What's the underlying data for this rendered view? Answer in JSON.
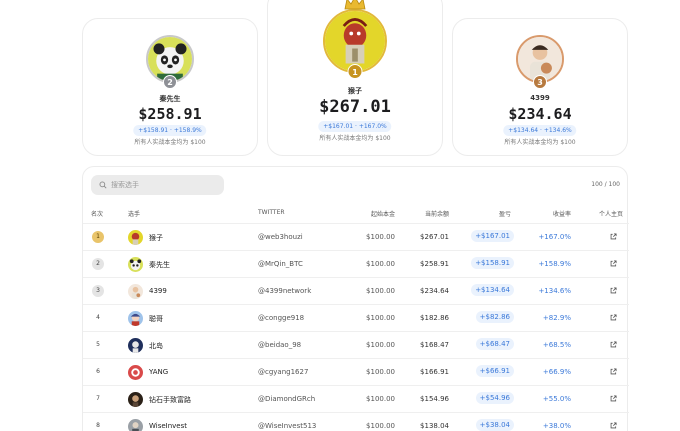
{
  "colors": {
    "accent": "#3b79d9",
    "pill_bg": "#eaf2fd",
    "gold": "#e2b93b",
    "silver": "#c9c9c9",
    "bronze": "#d99a6c"
  },
  "podium": [
    {
      "rank": "2",
      "name": "秦先生",
      "balance": "$258.91",
      "pnl": "+$158.91",
      "rate": "+158.9%",
      "note": "所有人实战本金均为 $100",
      "avatar": "panda-avatar"
    },
    {
      "rank": "1",
      "name": "猴子",
      "balance": "$267.01",
      "pnl": "+$167.01",
      "rate": "+167.0%",
      "note": "所有人实战本金均为 $100",
      "avatar": "monkey-avatar"
    },
    {
      "rank": "3",
      "name": "4399",
      "balance": "$234.64",
      "pnl": "+$134.64",
      "rate": "+134.6%",
      "note": "所有人实战本金均为 $100",
      "avatar": "person-with-dog-avatar"
    }
  ],
  "search": {
    "placeholder": "搜索选手"
  },
  "count": "100 / 100",
  "headers": {
    "rank": "名次",
    "player": "选手",
    "twitter": "TWITTER",
    "init": "起始本金",
    "cur": "当前余额",
    "pnl": "盈亏",
    "rate": "收益率",
    "home": "个人主页"
  },
  "rows": [
    {
      "rank": "1",
      "name": "猴子",
      "twitter": "@web3houzi",
      "init": "$100.00",
      "cur": "$267.01",
      "pnl": "+$167.01",
      "rate": "+167.0%",
      "avatar": "monkey-avatar"
    },
    {
      "rank": "2",
      "name": "秦先生",
      "twitter": "@MrQin_BTC",
      "init": "$100.00",
      "cur": "$258.91",
      "pnl": "+$158.91",
      "rate": "+158.9%",
      "avatar": "panda-avatar"
    },
    {
      "rank": "3",
      "name": "4399",
      "twitter": "@4399network",
      "init": "$100.00",
      "cur": "$234.64",
      "pnl": "+$134.64",
      "rate": "+134.6%",
      "avatar": "person-with-dog-avatar"
    },
    {
      "rank": "4",
      "name": "聪哥",
      "twitter": "@congge918",
      "init": "$100.00",
      "cur": "$182.86",
      "pnl": "+$82.86",
      "rate": "+82.9%",
      "avatar": "anime-avatar"
    },
    {
      "rank": "5",
      "name": "北岛",
      "twitter": "@beidao_98",
      "init": "$100.00",
      "cur": "$168.47",
      "pnl": "+$68.47",
      "rate": "+68.5%",
      "avatar": "dark-blue-avatar"
    },
    {
      "rank": "6",
      "name": "YANG",
      "twitter": "@cgyang1627",
      "init": "$100.00",
      "cur": "$166.91",
      "pnl": "+$66.91",
      "rate": "+66.9%",
      "avatar": "red-avatar"
    },
    {
      "rank": "7",
      "name": "钻石手致富路",
      "twitter": "@DiamondGRch",
      "init": "$100.00",
      "cur": "$154.96",
      "pnl": "+$54.96",
      "rate": "+55.0%",
      "avatar": "dark-avatar"
    },
    {
      "rank": "8",
      "name": "WiseInvest",
      "twitter": "@WiseInvest513",
      "init": "$100.00",
      "cur": "$138.04",
      "pnl": "+$38.04",
      "rate": "+38.0%",
      "avatar": "grey-avatar"
    }
  ]
}
